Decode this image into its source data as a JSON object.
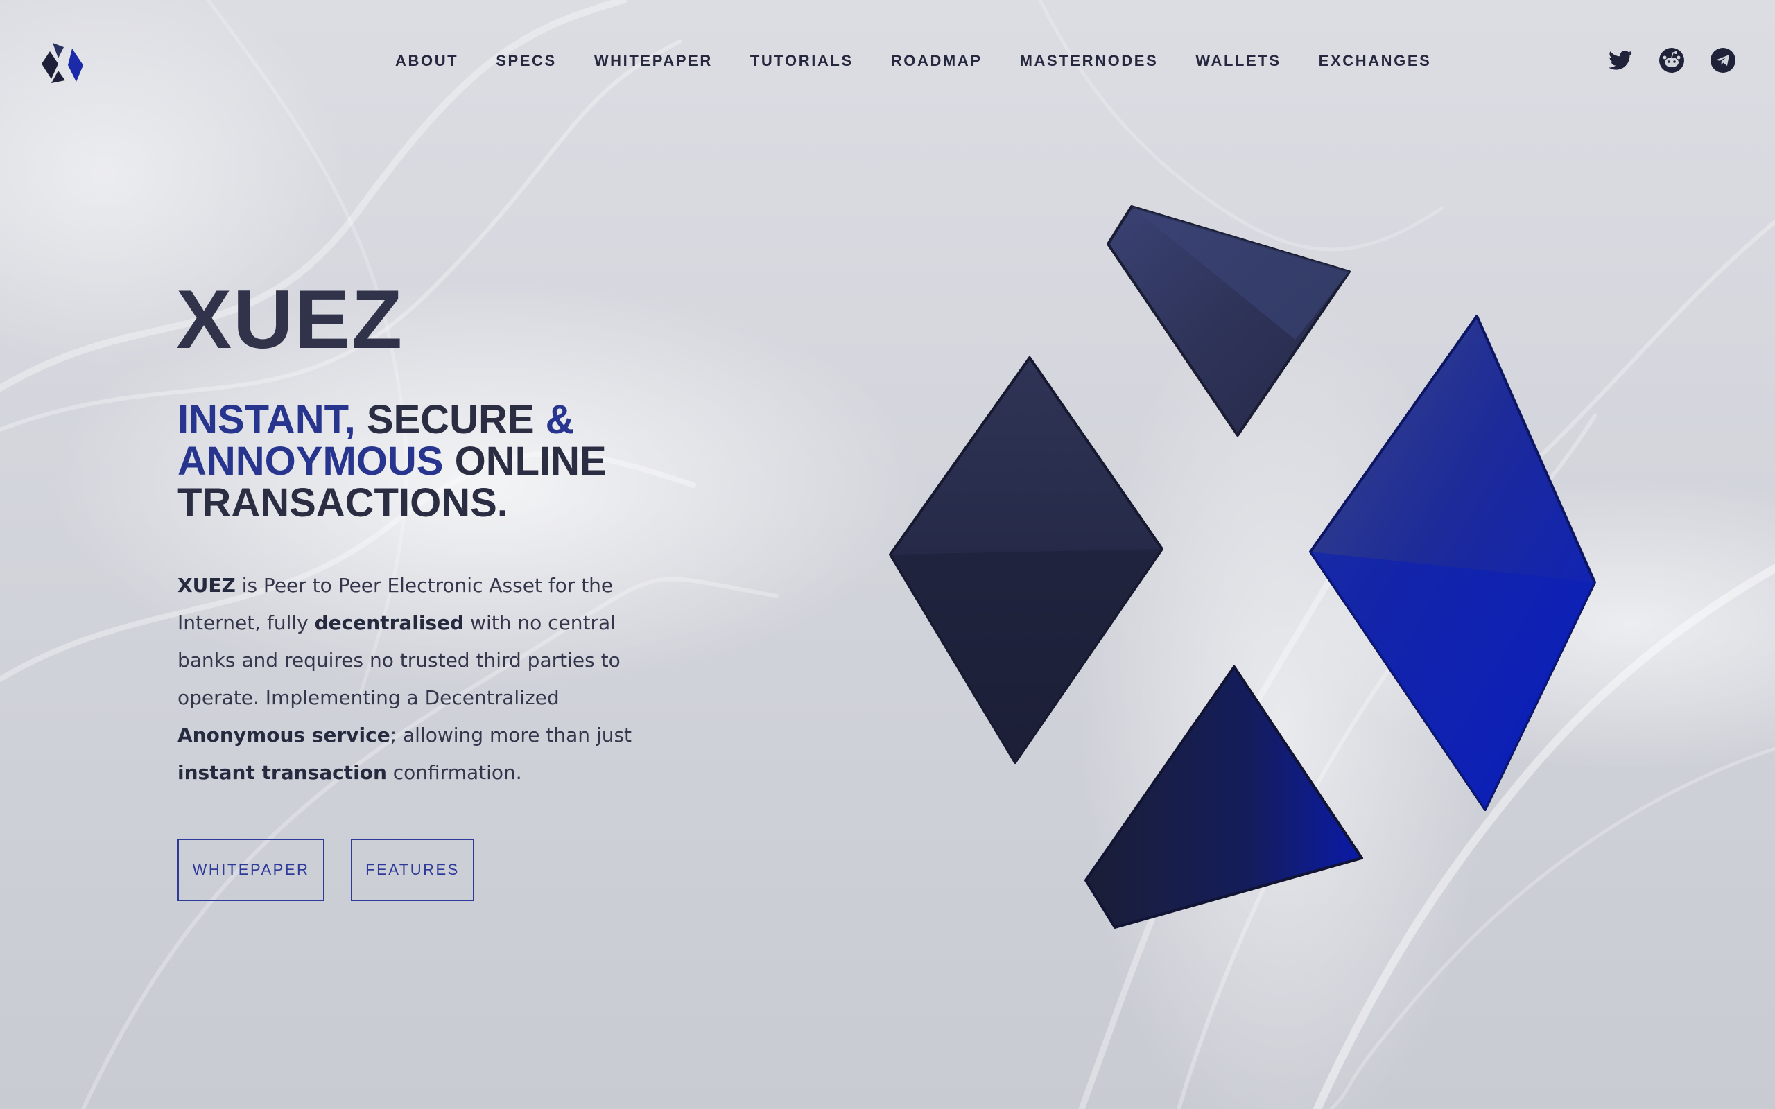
{
  "header": {
    "nav": [
      "ABOUT",
      "SPECS",
      "WHITEPAPER",
      "TUTORIALS",
      "ROADMAP",
      "MASTERNODES",
      "WALLETS",
      "EXCHANGES"
    ],
    "social": [
      "twitter-icon",
      "reddit-icon",
      "telegram-icon"
    ]
  },
  "hero": {
    "title": "XUEZ",
    "tagline": {
      "part1": "INSTANT,",
      "part2": " SECURE ",
      "part3": "&",
      "part4": "ANNOYMOUS",
      "part5": " ONLINE",
      "part6": "TRANSACTIONS."
    },
    "description": {
      "s1": "XUEZ",
      "s2": " is Peer to Peer Electronic Asset for the Internet, fully ",
      "s3": "decentralised",
      "s4": " with no central banks and requires no trusted third parties to operate. Implementing a Decentralized ",
      "s5": "Anonymous service",
      "s6": "; allowing more than just ",
      "s7": "instant transaction",
      "s8": " confirmation."
    },
    "buttons": {
      "whitepaper": "WHITEPAPER",
      "features": "FEATURES"
    }
  },
  "colors": {
    "accent": "#27358f",
    "dark": "#2a2e47",
    "emblem_blue": "#0a1fb5",
    "emblem_dark": "#1d2038"
  }
}
